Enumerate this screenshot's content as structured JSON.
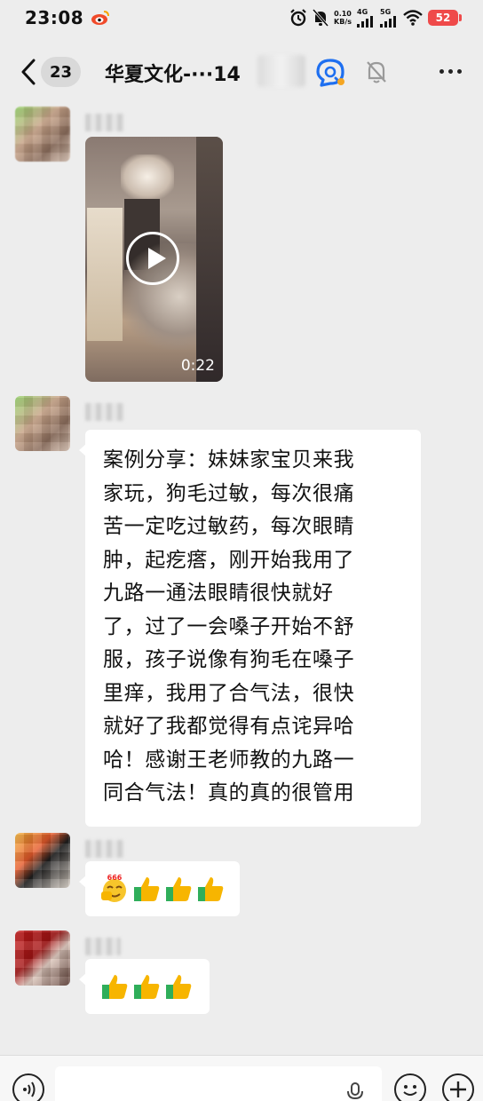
{
  "status_bar": {
    "time": "23:08",
    "net_speed_value": "0.10",
    "net_speed_unit": "KB/s",
    "signal_1_label": "4G",
    "signal_2_label": "5G",
    "battery": "52",
    "icons": [
      "weibo-icon",
      "alarm-icon",
      "mute-bell-icon",
      "signal-icon",
      "wifi-icon",
      "battery-icon"
    ]
  },
  "nav": {
    "unread_count": "23",
    "title": "华夏文化-···14",
    "icons": [
      "back-icon",
      "search-chat-icon",
      "mute-icon",
      "more-icon"
    ]
  },
  "messages": [
    {
      "type": "video",
      "duration": "0:22"
    },
    {
      "type": "text",
      "lines": [
        "案例分享：妹妹家宝贝来我",
        "家玩，狗毛过敏，每次很痛",
        "苦一定吃过敏药，每次眼睛",
        "肿，起疙瘩，刚开始我用了",
        "九路一通法眼睛很快就好",
        "了，过了一会嗓子开始不舒",
        "服，孩子说像有狗毛在嗓子",
        "里痒，我用了合气法，很快",
        "就好了我都觉得有点诧异哈",
        "哈！感谢王老师教的九路一",
        "同合气法！真的真的很管用"
      ]
    },
    {
      "type": "emoji",
      "badge": "666",
      "icons": [
        "666-emoji-icon",
        "thumbs-up-icon",
        "thumbs-up-icon",
        "thumbs-up-icon"
      ]
    },
    {
      "type": "emoji",
      "icons": [
        "thumbs-up-icon",
        "thumbs-up-icon",
        "thumbs-up-icon"
      ]
    }
  ],
  "input_bar": {
    "icons": [
      "voice-icon",
      "mic-icon",
      "emoji-icon",
      "plus-icon"
    ]
  },
  "colors": {
    "background": "#ededed",
    "bubble": "#ffffff",
    "battery": "#ef4a4a",
    "search_icon_blue": "#1e6ff0",
    "thumb_yellow": "#f7b500",
    "thumb_green": "#2fae5a"
  }
}
